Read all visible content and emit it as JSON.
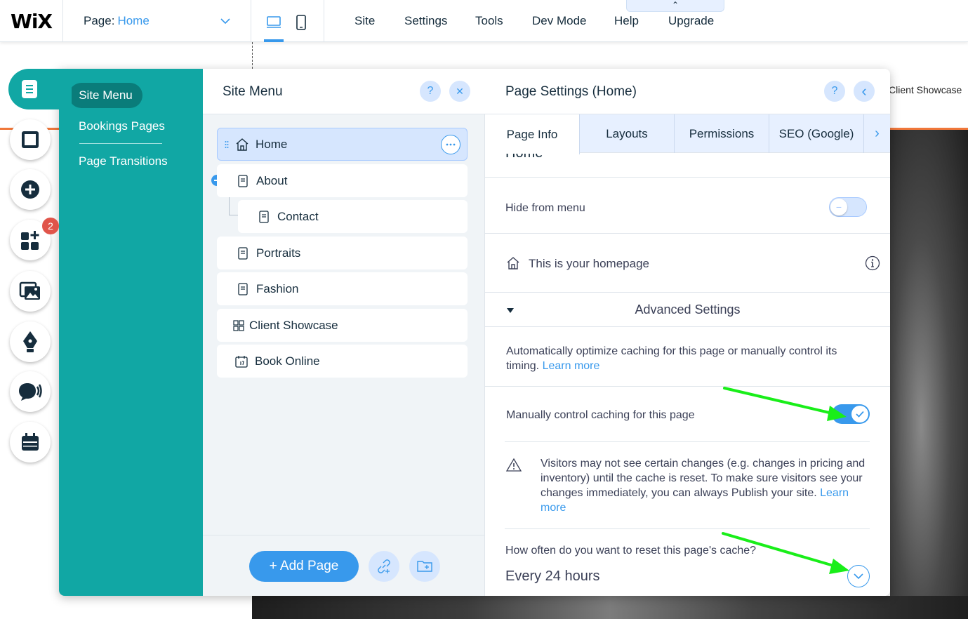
{
  "topbar": {
    "logo": "WiX",
    "page_label": "Page:",
    "page_name": "Home",
    "nav": [
      "Site",
      "Settings",
      "Tools",
      "Dev Mode",
      "Help",
      "Upgrade"
    ],
    "upgrade_tab_glyph": "⌃"
  },
  "canvas": {
    "client_showcase_label": "Client Showcase"
  },
  "left_toolbar": {
    "icons": [
      "pages-icon",
      "background-icon",
      "add-icon",
      "add-apps-icon",
      "media-icon",
      "blog-icon",
      "chat-icon",
      "bookings-calendar-icon"
    ],
    "apps_badge": "2"
  },
  "side_nav": {
    "items": [
      "Site Menu",
      "Bookings Pages",
      "Page Transitions"
    ]
  },
  "site_menu": {
    "title": "Site Menu",
    "help_glyph": "?",
    "close_glyph": "✕",
    "pages": [
      {
        "label": "Home",
        "icon": "home-icon"
      },
      {
        "label": "About",
        "icon": "page-icon"
      },
      {
        "label": "Contact",
        "icon": "page-icon"
      },
      {
        "label": "Portraits",
        "icon": "page-icon"
      },
      {
        "label": "Fashion",
        "icon": "page-icon"
      },
      {
        "label": "Client Showcase",
        "icon": "gallery-page-icon"
      },
      {
        "label": "Book Online",
        "icon": "calendar-page-icon"
      }
    ],
    "add_page_label": "+ Add Page"
  },
  "page_settings": {
    "title": "Page Settings (Home)",
    "help_glyph": "?",
    "back_glyph": "‹",
    "tabs": [
      "Page Info",
      "Layouts",
      "Permissions",
      "SEO (Google)"
    ],
    "more_tabs_glyph": "›",
    "clipped_text": "Home",
    "hide_from_menu_label": "Hide from menu",
    "homepage_text": "This is your homepage",
    "advanced_settings_label": "Advanced Settings",
    "caching_desc": "Automatically optimize caching for this page or manually control its timing.",
    "learn_more": "Learn more",
    "manual_caching_label": "Manually control caching for this page",
    "warning_text": "Visitors may not see certain changes (e.g. changes in pricing and inventory) until the cache is reset. To make sure visitors see your changes immediately, you can always Publish your site.",
    "learn_more_2": "Learn more",
    "reset_question": "How often do you want to reset this page's cache?",
    "reset_value": "Every 24 hours"
  },
  "annotations": {
    "arrow_color": "#19ee19"
  }
}
